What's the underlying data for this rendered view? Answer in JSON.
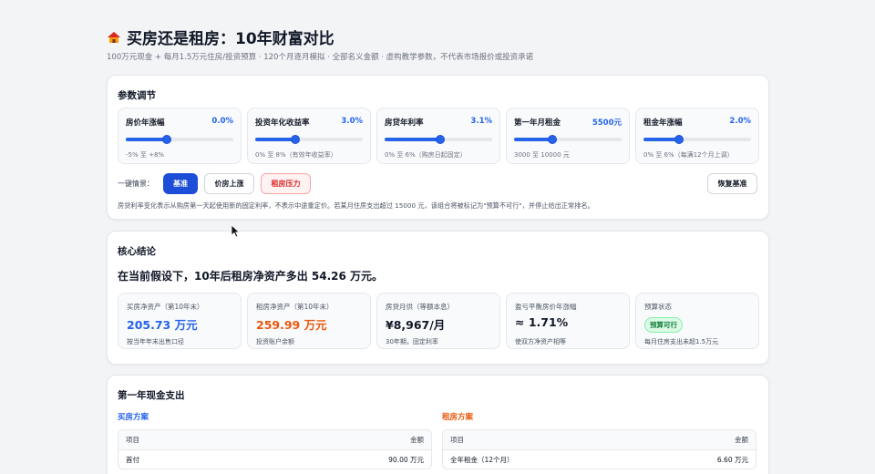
{
  "header": {
    "icon": "house-icon",
    "title": "买房还是租房：10年财富对比",
    "subtitle": "100万元现金 + 每月1.5万元住房/投资预算 · 120个月逐月模拟 · 全部名义金额 · 虚构教学参数，不代表市场报价或投资承诺"
  },
  "params": {
    "title": "参数调节",
    "sliders": [
      {
        "label": "房价年涨幅",
        "value": "0.0%",
        "hint": "-5% 至 +8%",
        "level": 0.385
      },
      {
        "label": "投资年化收益率",
        "value": "3.0%",
        "hint": "0% 至 8%（有效年收益率）",
        "level": 0.375
      },
      {
        "label": "房贷年利率",
        "value": "3.1%",
        "hint": "0% 至 6%（购房日起固定）",
        "level": 0.517
      },
      {
        "label": "第一年月租金",
        "value": "5500元",
        "hint": "3000 至 10000 元",
        "level": 0.357
      },
      {
        "label": "租金年涨幅",
        "value": "2.0%",
        "hint": "0% 至 6%（每满12个月上调）",
        "level": 0.333
      }
    ],
    "preset_label": "一键情景：",
    "presets": {
      "base": "基准",
      "price_up": "价房上涨",
      "pressure": "租房压力"
    },
    "reset": "恢复基准",
    "note": "房贷利率变化表示从购房第一天起使用新的固定利率，不表示中途重定价。若某月住房支出超过 15000 元，该组合将被标记为\"预算不可行\"，并停止给出正常排名。"
  },
  "core": {
    "title": "核心结论",
    "headline": "在当前假设下，10年后租房净资产多出 54.26 万元。",
    "metrics": [
      {
        "label": "买房净资产（第10年末）",
        "value": "205.73 万元",
        "sub": "按当年年末出售口径"
      },
      {
        "label": "租房净资产（第10年末）",
        "value": "259.99 万元",
        "sub": "投资账户余额"
      },
      {
        "label": "房贷月供（等额本息）",
        "value": "¥8,967/月",
        "sub": "30年期，固定利率"
      },
      {
        "label": "盈亏平衡房价年涨幅",
        "value": "≈ 1.71%",
        "sub": "使双方净资产相等"
      },
      {
        "label": "预算状态",
        "badge": "预算可行",
        "sub": "每月住房支出未超1.5万元"
      }
    ]
  },
  "cash": {
    "title": "第一年现金支出",
    "buy": {
      "title": "买房方案",
      "columns": [
        "项目",
        "金额"
      ],
      "rows": [
        {
          "item": "首付",
          "amount": "90.00 万元"
        }
      ]
    },
    "rent": {
      "title": "租房方案",
      "columns": [
        "项目",
        "金额"
      ],
      "rows": [
        {
          "item": "全年租金（12个月）",
          "amount": "6.60 万元"
        }
      ]
    }
  },
  "colors": {
    "accent": "#2563eb",
    "rent": "#ea580c",
    "ok": "#15803d",
    "danger": "#dc2626"
  }
}
